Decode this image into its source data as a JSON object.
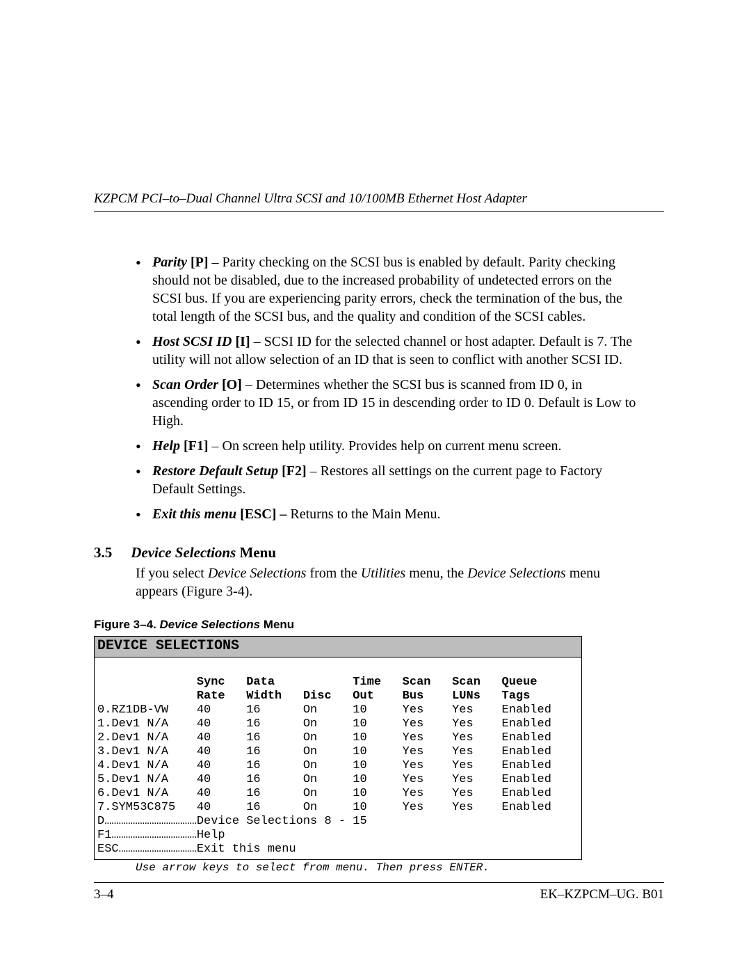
{
  "header": "KZPCM PCI–to–Dual Channel Ultra SCSI and 10/100MB Ethernet Host Adapter",
  "bullets": {
    "parity": {
      "label": "Parity",
      "key": "[P]",
      "text": " – Parity checking on the SCSI bus is enabled by default.  Parity checking should not be disabled, due to the increased probability of undetected errors on the SCSI bus.  If you are experiencing parity errors, check the termination of the bus, the total length of the SCSI bus, and the quality and condition of the SCSI cables."
    },
    "hostid": {
      "label": "Host SCSI ID",
      "key": "[I]",
      "text": " – SCSI ID for the selected channel or host adapter.  Default is 7.  The utility will not allow selection of an ID that is seen to conflict with another SCSI ID."
    },
    "scanorder": {
      "label": "Scan Order",
      "key": "[O]",
      "text": " – Determines whether the SCSI bus is scanned from ID 0, in ascending order to ID 15, or from ID 15 in descending order to ID 0.  Default is Low to High."
    },
    "help": {
      "label": "Help",
      "key": "[F1]",
      "text": " – On screen help utility.  Provides help on current menu screen."
    },
    "restore": {
      "label": "Restore Default Setup",
      "key": "[F2]",
      "text": " – Restores all settings on the current page to Factory Default Settings."
    },
    "exit": {
      "label": "Exit this menu",
      "key": "[ESC]",
      "text_bold": " –",
      "text": " Returns to the Main Menu."
    }
  },
  "section": {
    "num": "3.5",
    "title_italic": "Device Selections",
    "title_rest": " Menu"
  },
  "intro": {
    "pre": "If you select ",
    "i1": "Device Selections",
    "mid": " from the ",
    "i2": "Utilities",
    "mid2": " menu, the ",
    "i3": "Device Selections",
    "end": " menu appears (Figure 3-4)."
  },
  "figure": {
    "label": "Figure 3–4.  ",
    "italic": "Device Selections",
    "rest": " Menu"
  },
  "device_box": {
    "title": "DEVICE SELECTIONS",
    "headers": [
      [
        "Sync",
        "Data",
        "",
        "Time",
        "Scan",
        "Scan",
        "Queue"
      ],
      [
        "Rate",
        "Width",
        "Disc",
        "Out",
        "Bus",
        "LUNs",
        "Tags"
      ]
    ],
    "rows": [
      {
        "name": "0.RZ1DB-VW",
        "sync": "40",
        "width": "16",
        "disc": "On",
        "time": "10",
        "bus": "Yes",
        "luns": "Yes",
        "tags": "Enabled"
      },
      {
        "name": "1.Dev1 N/A",
        "sync": "40",
        "width": "16",
        "disc": "On",
        "time": "10",
        "bus": "Yes",
        "luns": "Yes",
        "tags": "Enabled"
      },
      {
        "name": "2.Dev1 N/A",
        "sync": "40",
        "width": "16",
        "disc": "On",
        "time": "10",
        "bus": "Yes",
        "luns": "Yes",
        "tags": "Enabled"
      },
      {
        "name": "3.Dev1 N/A",
        "sync": "40",
        "width": "16",
        "disc": "On",
        "time": "10",
        "bus": "Yes",
        "luns": "Yes",
        "tags": "Enabled"
      },
      {
        "name": "4.Dev1 N/A",
        "sync": "40",
        "width": "16",
        "disc": "On",
        "time": "10",
        "bus": "Yes",
        "luns": "Yes",
        "tags": "Enabled"
      },
      {
        "name": "5.Dev1 N/A",
        "sync": "40",
        "width": "16",
        "disc": "On",
        "time": "10",
        "bus": "Yes",
        "luns": "Yes",
        "tags": "Enabled"
      },
      {
        "name": "6.Dev1 N/A",
        "sync": "40",
        "width": "16",
        "disc": "On",
        "time": "10",
        "bus": "Yes",
        "luns": "Yes",
        "tags": "Enabled"
      },
      {
        "name": "7.SYM53C875",
        "sync": "40",
        "width": "16",
        "disc": "On",
        "time": "10",
        "bus": "Yes",
        "luns": "Yes",
        "tags": "Enabled"
      }
    ],
    "footer_lines": [
      {
        "key": "D",
        "dots": "…………………………………",
        "text": "Device Selections 8 - 15"
      },
      {
        "key": "F1",
        "dots": "………………………………",
        "text": "Help"
      },
      {
        "key": "ESC",
        "dots": "……………………………",
        "text": "Exit this menu"
      }
    ]
  },
  "hint": "Use arrow keys to select from menu. Then press ENTER.",
  "footer": {
    "left": "3–4",
    "right": "EK–KZPCM–UG. B01"
  }
}
